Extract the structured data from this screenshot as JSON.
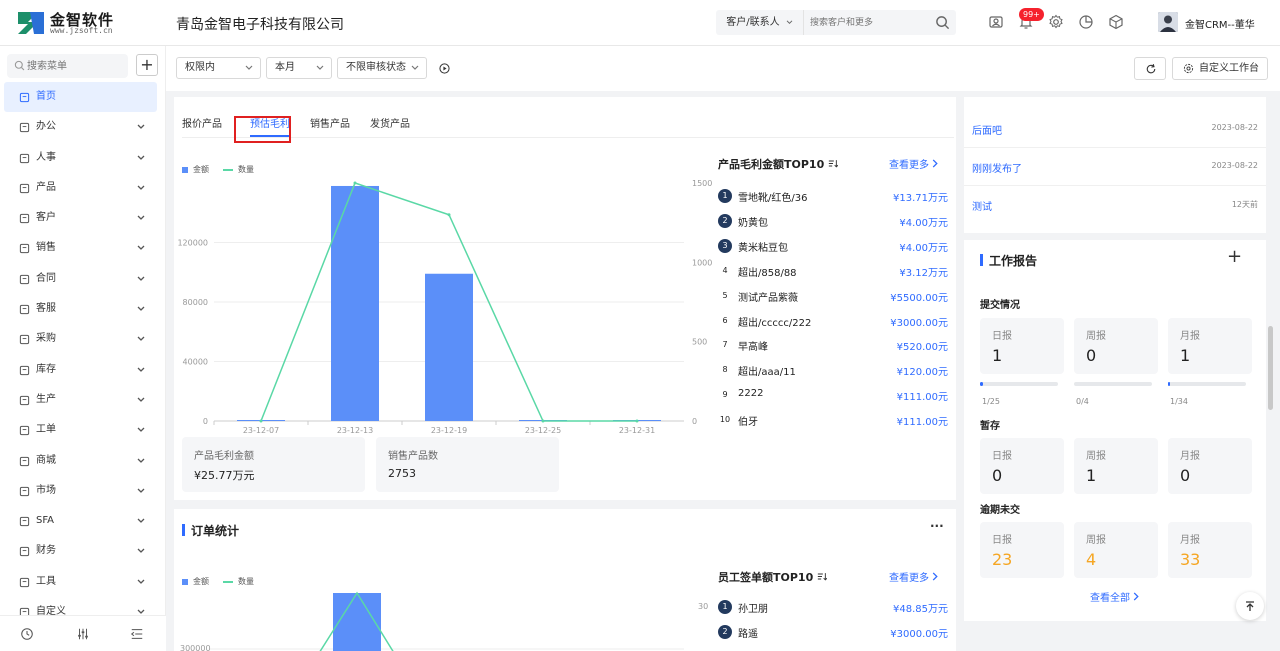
{
  "header": {
    "logo_name": "金智软件",
    "logo_url": "www.jzsoft.cn",
    "company": "青岛金智电子科技有限公司",
    "search_type": "客户/联系人",
    "search_placeholder": "搜索客户和更多",
    "badge": "99+",
    "user_name": "金智CRM--董华"
  },
  "sidebar": {
    "search_placeholder": "搜索菜单",
    "add": "+",
    "items": [
      {
        "label": "首页",
        "icon": "home-icon",
        "active": true
      },
      {
        "label": "办公",
        "icon": "office-icon"
      },
      {
        "label": "人事",
        "icon": "person-icon"
      },
      {
        "label": "产品",
        "icon": "box-icon"
      },
      {
        "label": "客户",
        "icon": "customer-icon"
      },
      {
        "label": "销售",
        "icon": "sales-icon"
      },
      {
        "label": "合同",
        "icon": "contract-icon"
      },
      {
        "label": "客服",
        "icon": "service-icon"
      },
      {
        "label": "采购",
        "icon": "purchase-icon"
      },
      {
        "label": "库存",
        "icon": "warehouse-icon"
      },
      {
        "label": "生产",
        "icon": "production-icon"
      },
      {
        "label": "工单",
        "icon": "ticket-icon"
      },
      {
        "label": "商城",
        "icon": "mall-icon"
      },
      {
        "label": "市场",
        "icon": "market-icon"
      },
      {
        "label": "SFA",
        "icon": "sfa-icon"
      },
      {
        "label": "财务",
        "icon": "finance-icon"
      },
      {
        "label": "工具",
        "icon": "tool-icon"
      },
      {
        "label": "自定义",
        "icon": "custom-icon"
      }
    ]
  },
  "toolbar": {
    "scope": "权限内",
    "period": "本月",
    "status": "不限审核状态",
    "refresh_label": "",
    "custom_label": "自定义工作台"
  },
  "profit_panel": {
    "tabs": [
      "报价产品",
      "预估毛利",
      "销售产品",
      "发货产品"
    ],
    "active_tab": 1,
    "legend_amount": "金额",
    "legend_qty": "数量",
    "stat1_label": "产品毛利金额",
    "stat1_value": "¥25.77万元",
    "stat2_label": "销售产品数",
    "stat2_value": "2753",
    "top_title": "产品毛利金额TOP10",
    "more": "查看更多",
    "top": [
      {
        "rank": "1",
        "name": "雪地靴/红色/36",
        "amount": "¥13.71万元"
      },
      {
        "rank": "2",
        "name": "奶黄包",
        "amount": "¥4.00万元"
      },
      {
        "rank": "3",
        "name": "黄米粘豆包",
        "amount": "¥4.00万元"
      },
      {
        "rank": "4",
        "name": "超出/858/88",
        "amount": "¥3.12万元"
      },
      {
        "rank": "5",
        "name": "测试产品紫薇",
        "amount": "¥5500.00元"
      },
      {
        "rank": "6",
        "name": "超出/ccccc/222",
        "amount": "¥3000.00元"
      },
      {
        "rank": "7",
        "name": "早高峰",
        "amount": "¥520.00元"
      },
      {
        "rank": "8",
        "name": "超出/aaa/11",
        "amount": "¥120.00元"
      },
      {
        "rank": "9",
        "name": "2222",
        "amount": "¥111.00元"
      },
      {
        "rank": "10",
        "name": "伯牙",
        "amount": "¥111.00元"
      }
    ]
  },
  "order_panel": {
    "title": "订单统计",
    "menu": "···",
    "legend_amount": "金额",
    "legend_qty": "数量",
    "top_title": "员工签单额TOP10",
    "more": "查看更多",
    "top": [
      {
        "rank": "1",
        "name": "孙卫朋",
        "amount": "¥48.85万元"
      },
      {
        "rank": "2",
        "name": "路遥",
        "amount": "¥3000.00元"
      }
    ],
    "y_left_top": "300000",
    "y_right_top": "30"
  },
  "news": [
    {
      "title": "后面吧",
      "date": "2023-08-22"
    },
    {
      "title": "刚刚发布了",
      "date": "2023-08-22"
    },
    {
      "title": "测试",
      "date": "12天前"
    }
  ],
  "report": {
    "title": "工作报告",
    "add": "+",
    "submit_title": "提交情况",
    "draft_title": "暂存",
    "overdue_title": "逾期未交",
    "labels": [
      "日报",
      "周报",
      "月报"
    ],
    "submit": [
      "1",
      "0",
      "1"
    ],
    "submit_progress": [
      "1/25",
      "0/4",
      "1/34"
    ],
    "submit_fraction": [
      0.04,
      0,
      0.03
    ],
    "draft": [
      "0",
      "1",
      "0"
    ],
    "overdue": [
      "23",
      "4",
      "33"
    ],
    "view_all": "查看全部"
  },
  "chart_data": [
    {
      "type": "bar",
      "categories": [
        "23-12-07",
        "23-12-13",
        "23-12-19",
        "23-12-25",
        "23-12-31"
      ],
      "series": [
        {
          "name": "金额",
          "type": "bar",
          "values": [
            0,
            158000,
            99000,
            0,
            0
          ]
        },
        {
          "name": "数量",
          "type": "line",
          "axis": "right",
          "values": [
            0,
            1500,
            1300,
            0,
            0
          ]
        }
      ],
      "ylim": [
        0,
        160000
      ],
      "y_ticks": [
        0,
        40000,
        80000,
        120000
      ],
      "y2lim": [
        0,
        1500
      ],
      "y2_ticks": [
        0,
        500,
        1000,
        1500
      ],
      "grid": true,
      "legend": "top-left"
    }
  ]
}
